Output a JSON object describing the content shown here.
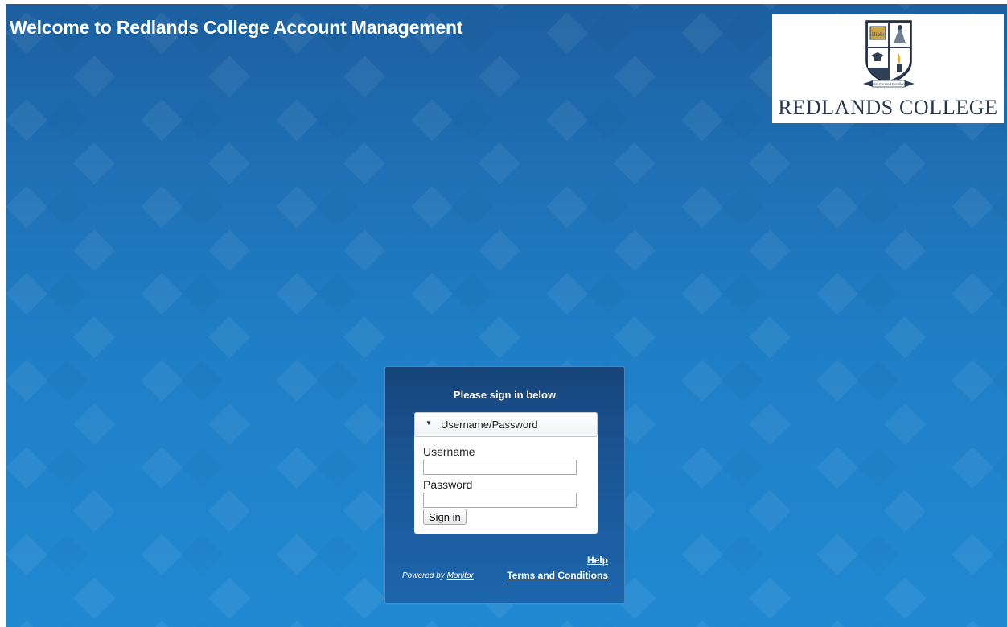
{
  "header": {
    "title": "Welcome to Redlands College Account Management"
  },
  "logo": {
    "bible_label": "Bible",
    "motto": "Christ-Centred Excellence",
    "name": "REDLANDS COLLEGE"
  },
  "signin": {
    "heading": "Please sign in below",
    "method_label": "Username/Password",
    "username_label": "Username",
    "username_value": "",
    "password_label": "Password",
    "password_value": "",
    "button_label": "Sign in"
  },
  "footer": {
    "powered_by_prefix": "Powered by",
    "powered_by_link": "Monitor",
    "help_link": "Help",
    "terms_link": "Terms and Conditions"
  },
  "colors": {
    "background_top": "#1c5fa0",
    "background_bottom": "#2189d2",
    "panel": "#1a5594",
    "logo_text": "#25384f"
  },
  "icons": {
    "method_toggle": "caret-down-icon"
  }
}
